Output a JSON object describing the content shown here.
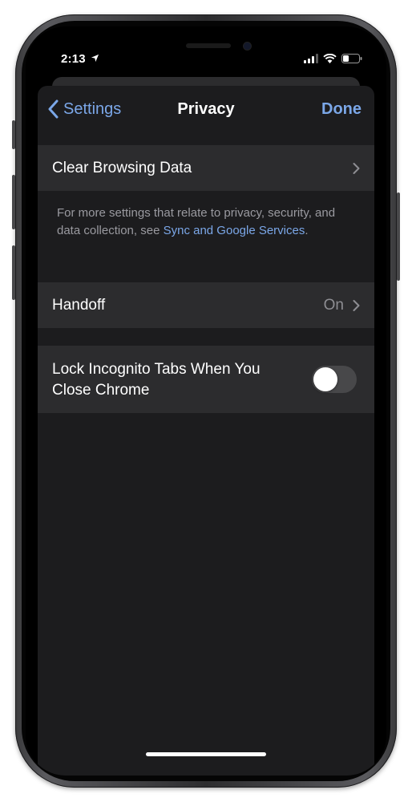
{
  "status_bar": {
    "time": "2:13",
    "location_icon": "location-arrow-icon",
    "signal_icon": "cellular-signal-icon",
    "wifi_icon": "wifi-icon",
    "battery_icon": "battery-icon"
  },
  "nav": {
    "back_label": "Settings",
    "title": "Privacy",
    "done_label": "Done"
  },
  "rows": {
    "clear_browsing": {
      "label": "Clear Browsing Data"
    },
    "handoff": {
      "label": "Handoff",
      "value": "On"
    },
    "lock_incognito": {
      "label": "Lock Incognito Tabs When You Close Chrome",
      "enabled": false
    }
  },
  "footnote": {
    "text": "For more settings that relate to privacy, security, and data collection, see ",
    "link": "Sync and Google Services",
    "suffix": "."
  },
  "colors": {
    "accent": "#7ba7e8",
    "background": "#1c1c1e",
    "cell": "#2c2c2e"
  }
}
